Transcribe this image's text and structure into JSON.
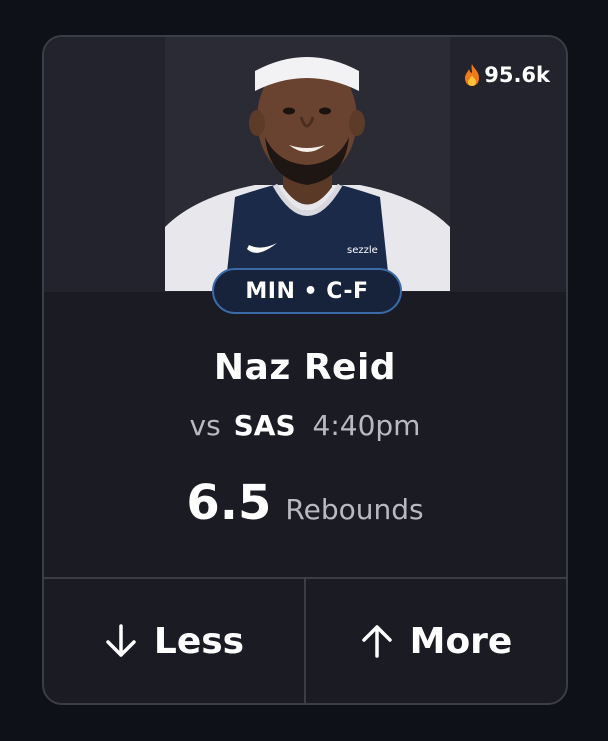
{
  "trend": {
    "icon": "fire-icon",
    "count": "95.6k"
  },
  "player": {
    "team_position": "MIN • C-F",
    "name": "Naz Reid",
    "photo_icon": "player-headshot",
    "jersey_sponsor": "sezzle"
  },
  "matchup": {
    "prefix": "vs",
    "opponent": "SAS",
    "time": "4:40pm"
  },
  "projection": {
    "value": "6.5",
    "stat": "Rebounds"
  },
  "actions": {
    "less_label": "Less",
    "less_icon": "arrow-down-icon",
    "more_label": "More",
    "more_icon": "arrow-up-icon"
  },
  "colors": {
    "background": "#0f1118",
    "card": "#1b1b24",
    "border": "#3c3d48",
    "pill_border": "#3a6aa8",
    "pill_bg": "#16233a",
    "fire": "#f07a1a"
  }
}
